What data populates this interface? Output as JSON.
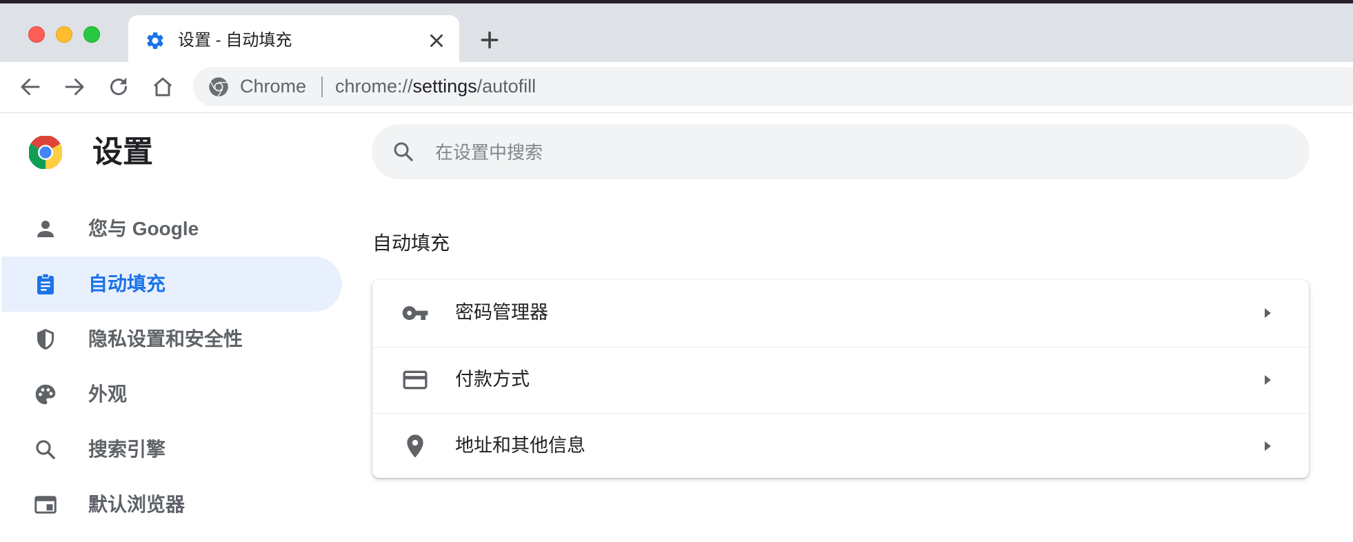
{
  "tab": {
    "title": "设置 - 自动填充",
    "icon": "gear-icon"
  },
  "omnibox": {
    "chip": "Chrome",
    "url_prefix": "chrome://",
    "url_host": "settings",
    "url_path": "/autofill"
  },
  "page": {
    "title": "设置"
  },
  "search": {
    "placeholder": "在设置中搜索"
  },
  "sidebar": {
    "items": [
      {
        "label": "您与 Google",
        "icon": "person-icon",
        "active": false
      },
      {
        "label": "自动填充",
        "icon": "assignment-icon",
        "active": true
      },
      {
        "label": "隐私设置和安全性",
        "icon": "shield-icon",
        "active": false
      },
      {
        "label": "外观",
        "icon": "palette-icon",
        "active": false
      },
      {
        "label": "搜索引擎",
        "icon": "search-icon",
        "active": false
      },
      {
        "label": "默认浏览器",
        "icon": "browser-window-icon",
        "active": false
      }
    ]
  },
  "section": {
    "title": "自动填充",
    "rows": [
      {
        "label": "密码管理器",
        "icon": "key-icon"
      },
      {
        "label": "付款方式",
        "icon": "credit-card-icon"
      },
      {
        "label": "地址和其他信息",
        "icon": "location-pin-icon"
      }
    ]
  },
  "colors": {
    "accent": "#1a73e8",
    "active_bg": "#e8f0fe",
    "tabstrip": "#dee1e6"
  }
}
